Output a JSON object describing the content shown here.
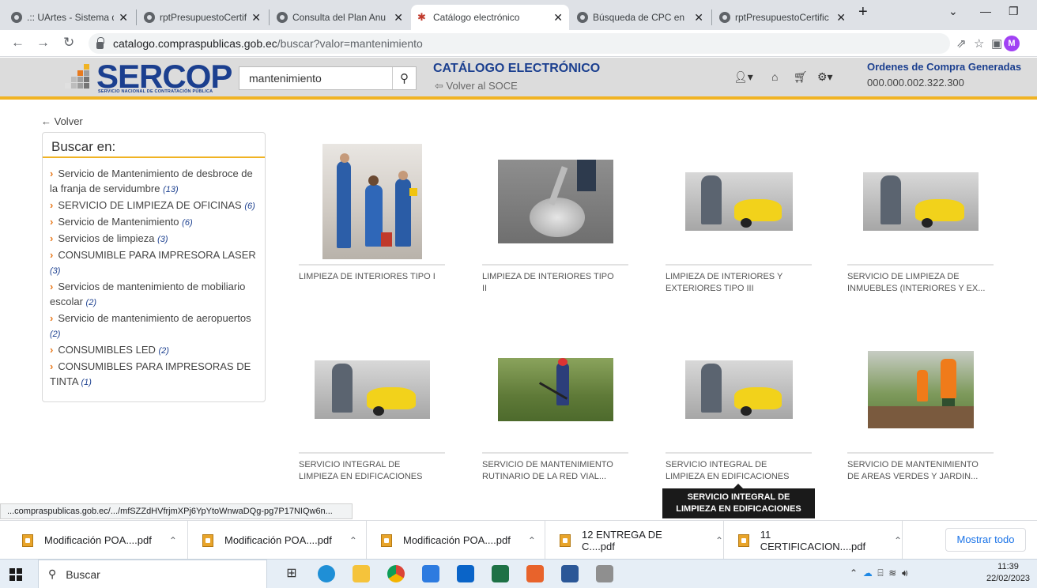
{
  "browser": {
    "tabs": [
      {
        "title": ".:: UArtes - Sistema de"
      },
      {
        "title": "rptPresupuestoCertific"
      },
      {
        "title": "Consulta del Plan Anu"
      },
      {
        "title": "Catálogo electrónico"
      },
      {
        "title": "Búsqueda de CPC en"
      },
      {
        "title": "rptPresupuestoCertific"
      }
    ],
    "url_host": "catalogo.compraspublicas.gob.ec",
    "url_path": "/buscar?valor=mantenimiento",
    "profile_initial": "M"
  },
  "header": {
    "logo_word": "SERCOP",
    "logo_tagline": "SERVICIO NACIONAL DE CONTRATACIÓN PÚBLICA",
    "search_value": "mantenimiento",
    "catalog_title": "CATÁLOGO ELECTRÓNICO",
    "back_soce": "Volver al SOCE",
    "orders_title": "Ordenes de Compra Generadas",
    "orders_value": "000.000.002.322.300"
  },
  "sidebar": {
    "back_label": "Volver",
    "title": "Buscar en:",
    "items": [
      {
        "label": "Servicio de Mantenimiento de desbroce de la franja de servidumbre",
        "count": "(13)"
      },
      {
        "label": "SERVICIO DE LIMPIEZA DE OFICINAS",
        "count": "(6)"
      },
      {
        "label": "Servicio de Mantenimiento",
        "count": "(6)"
      },
      {
        "label": "Servicios de limpieza",
        "count": "(3)"
      },
      {
        "label": "CONSUMIBLE PARA IMPRESORA LASER",
        "count": "(3)"
      },
      {
        "label": "Servicios de mantenimiento de mobiliario escolar",
        "count": "(2)"
      },
      {
        "label": "Servicio de mantenimiento de aeropuertos",
        "count": "(2)"
      },
      {
        "label": "CONSUMIBLES LED",
        "count": "(2)"
      },
      {
        "label": "CONSUMIBLES PARA IMPRESORAS DE TINTA",
        "count": "(1)"
      }
    ]
  },
  "products": [
    {
      "title_line1": "LIMPIEZA DE INTERIORES TIPO I",
      "title_line2": "",
      "image": "cleaning-staff-photo"
    },
    {
      "title_line1": "LIMPIEZA DE INTERIORES TIPO",
      "title_line2": "II",
      "image": "floor-polisher-photo"
    },
    {
      "title_line1": "LIMPIEZA DE INTERIORES Y",
      "title_line2": "EXTERIORES TIPO III",
      "image": "yellow-scrubber-photo"
    },
    {
      "title_line1": "SERVICIO DE LIMPIEZA DE",
      "title_line2": "INMUEBLES (INTERIORES Y EX...",
      "image": "yellow-scrubber-photo"
    },
    {
      "title_line1": "SERVICIO INTEGRAL DE",
      "title_line2": "LIMPIEZA EN EDIFICACIONES",
      "image": "yellow-scrubber-photo"
    },
    {
      "title_line1": "SERVICIO DE MANTENIMIENTO",
      "title_line2": "RUTINARIO DE LA RED VIAL...",
      "image": "brush-cutter-photo"
    },
    {
      "title_line1": "SERVICIO INTEGRAL DE",
      "title_line2": "LIMPIEZA EN EDIFICACIONES",
      "image": "yellow-scrubber-photo"
    },
    {
      "title_line1": "SERVICIO DE MANTENIMIENTO",
      "title_line2": "DE AREAS VERDES Y JARDIN...",
      "image": "gardeners-photo"
    }
  ],
  "tooltip": {
    "line1": "SERVICIO INTEGRAL DE",
    "line2": "LIMPIEZA EN EDIFICACIONES"
  },
  "status_url": "...compraspublicas.gob.ec/.../mfSZZdHVfrjmXPj6YpYtoWnwaDQg-pg7P17NIQw6n...",
  "downloads": {
    "items": [
      "Modificación POA....pdf",
      "Modificación POA....pdf",
      "Modificación POA....pdf",
      "12 ENTREGA DE C....pdf",
      "11 CERTIFICACION....pdf"
    ],
    "show_all": "Mostrar todo"
  },
  "taskbar": {
    "search_placeholder": "Buscar",
    "time": "11:39",
    "date": "22/02/2023"
  },
  "colors": {
    "brand_blue": "#1b3f8f",
    "accent_yellow": "#f0b323",
    "chevron_orange": "#e87a1e"
  }
}
